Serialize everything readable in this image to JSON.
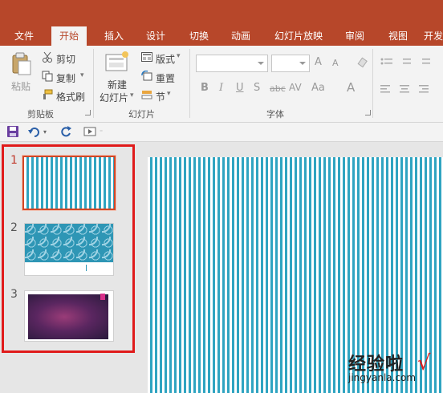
{
  "tabs": [
    "文件",
    "开始",
    "插入",
    "设计",
    "切换",
    "动画",
    "幻灯片放映",
    "审阅",
    "视图",
    "开发"
  ],
  "active_tab": "开始",
  "ribbon": {
    "clipboard": {
      "paste": "粘贴",
      "cut": "剪切",
      "copy": "复制",
      "format_painter": "格式刷",
      "group_label": "剪贴板"
    },
    "slides": {
      "new_slide": "新建",
      "new_slide_line2": "幻灯片",
      "layout": "版式",
      "reset": "重置",
      "section": "节",
      "group_label": "幻灯片"
    },
    "font": {
      "bold": "B",
      "italic": "I",
      "underline": "U",
      "shadow": "S",
      "strikethrough": "abc",
      "char_spacing": "AV",
      "change_case": "Aa",
      "font_color": "A",
      "grow_font": "A",
      "shrink_font": "A",
      "group_label": "字体"
    }
  },
  "qat": {
    "icons": [
      "save-icon",
      "undo-icon",
      "redo-icon",
      "start-from-beginning-icon"
    ]
  },
  "slides": [
    {
      "number": "1",
      "theme": "vertical-stripes",
      "selected": true
    },
    {
      "number": "2",
      "theme": "circle-pattern",
      "selected": false
    },
    {
      "number": "3",
      "theme": "purple-gradient",
      "selected": false
    }
  ],
  "watermark": {
    "title": "经验啦",
    "url": "jingyanla.com",
    "check": "√"
  },
  "colors": {
    "accent": "#b7472a",
    "highlight": "#e01b1b",
    "stripe": "#2fa4c1"
  }
}
